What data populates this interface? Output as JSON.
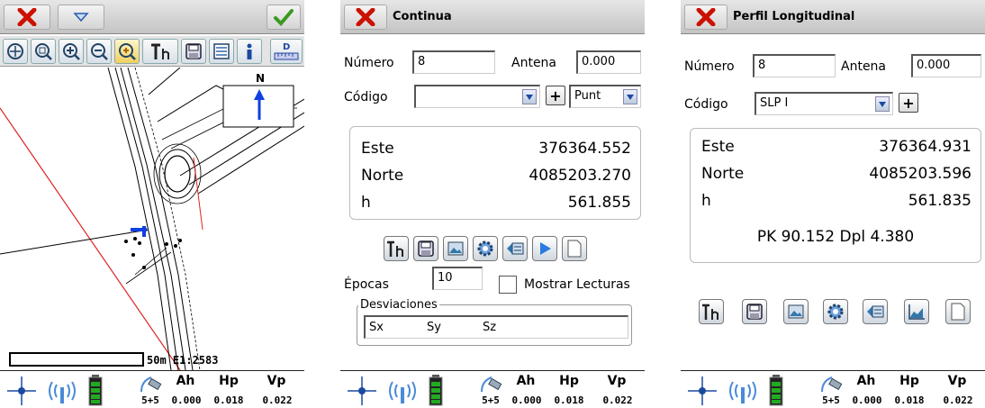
{
  "screen1": {
    "scale_text": "50m E1:2583",
    "north_label": "N",
    "status": {
      "ah_label": "Ah",
      "hp_label": "Hp",
      "vp_label": "Vp",
      "sats": "5+5",
      "ah": "0.000",
      "hp": "0.018",
      "vp": "0.022"
    }
  },
  "screen2": {
    "title": "Continua",
    "numero_label": "Número",
    "numero_value": "8",
    "antena_label": "Antena",
    "antena_value": "0.000",
    "codigo_label": "Código",
    "codigo_value": "",
    "tipo_value": "Punt",
    "este_label": "Este",
    "este_value": "376364.552",
    "norte_label": "Norte",
    "norte_value": "4085203.270",
    "h_label": "h",
    "h_value": "561.855",
    "epocas_label": "Épocas",
    "epocas_value": "10",
    "mostrar_label": "Mostrar Lecturas",
    "desv_label": "Desviaciones",
    "sx": "Sx",
    "sy": "Sy",
    "sz": "Sz",
    "status": {
      "ah_label": "Ah",
      "hp_label": "Hp",
      "vp_label": "Vp",
      "sats": "5+5",
      "ah": "0.000",
      "hp": "0.018",
      "vp": "0.022"
    }
  },
  "screen3": {
    "title": "Perfil Longitudinal",
    "numero_label": "Número",
    "numero_value": "8",
    "antena_label": "Antena",
    "antena_value": "0.000",
    "codigo_label": "Código",
    "codigo_value": "SLP I",
    "este_label": "Este",
    "este_value": "376364.931",
    "norte_label": "Norte",
    "norte_value": "4085203.596",
    "h_label": "h",
    "h_value": "561.835",
    "pk_text": "PK 90.152 Dpl 4.380",
    "status": {
      "ah_label": "Ah",
      "hp_label": "Hp",
      "vp_label": "Vp",
      "sats": "5+5",
      "ah": "0.000",
      "hp": "0.018",
      "vp": "0.022"
    }
  },
  "colors": {
    "close_red": "#cc1100",
    "accept_green": "#3a9a20",
    "north_arrow": "#1040e0",
    "map_red_line": "#dd2222",
    "battery_green": "#22aa22"
  },
  "icons": [
    "close-icon",
    "menu-dropdown-icon",
    "accept-check-icon",
    "zoom-extents-icon",
    "zoom-window-icon",
    "zoom-in-icon",
    "zoom-out-icon",
    "zoom-pan-icon",
    "antenna-height-icon",
    "save-icon",
    "layers-icon",
    "info-icon",
    "distance-icon",
    "gps-crosshair-icon",
    "radio-signal-icon",
    "battery-icon",
    "satellite-icon",
    "settings-icon",
    "photo-icon",
    "play-icon",
    "page-icon",
    "profile-chart-icon"
  ]
}
